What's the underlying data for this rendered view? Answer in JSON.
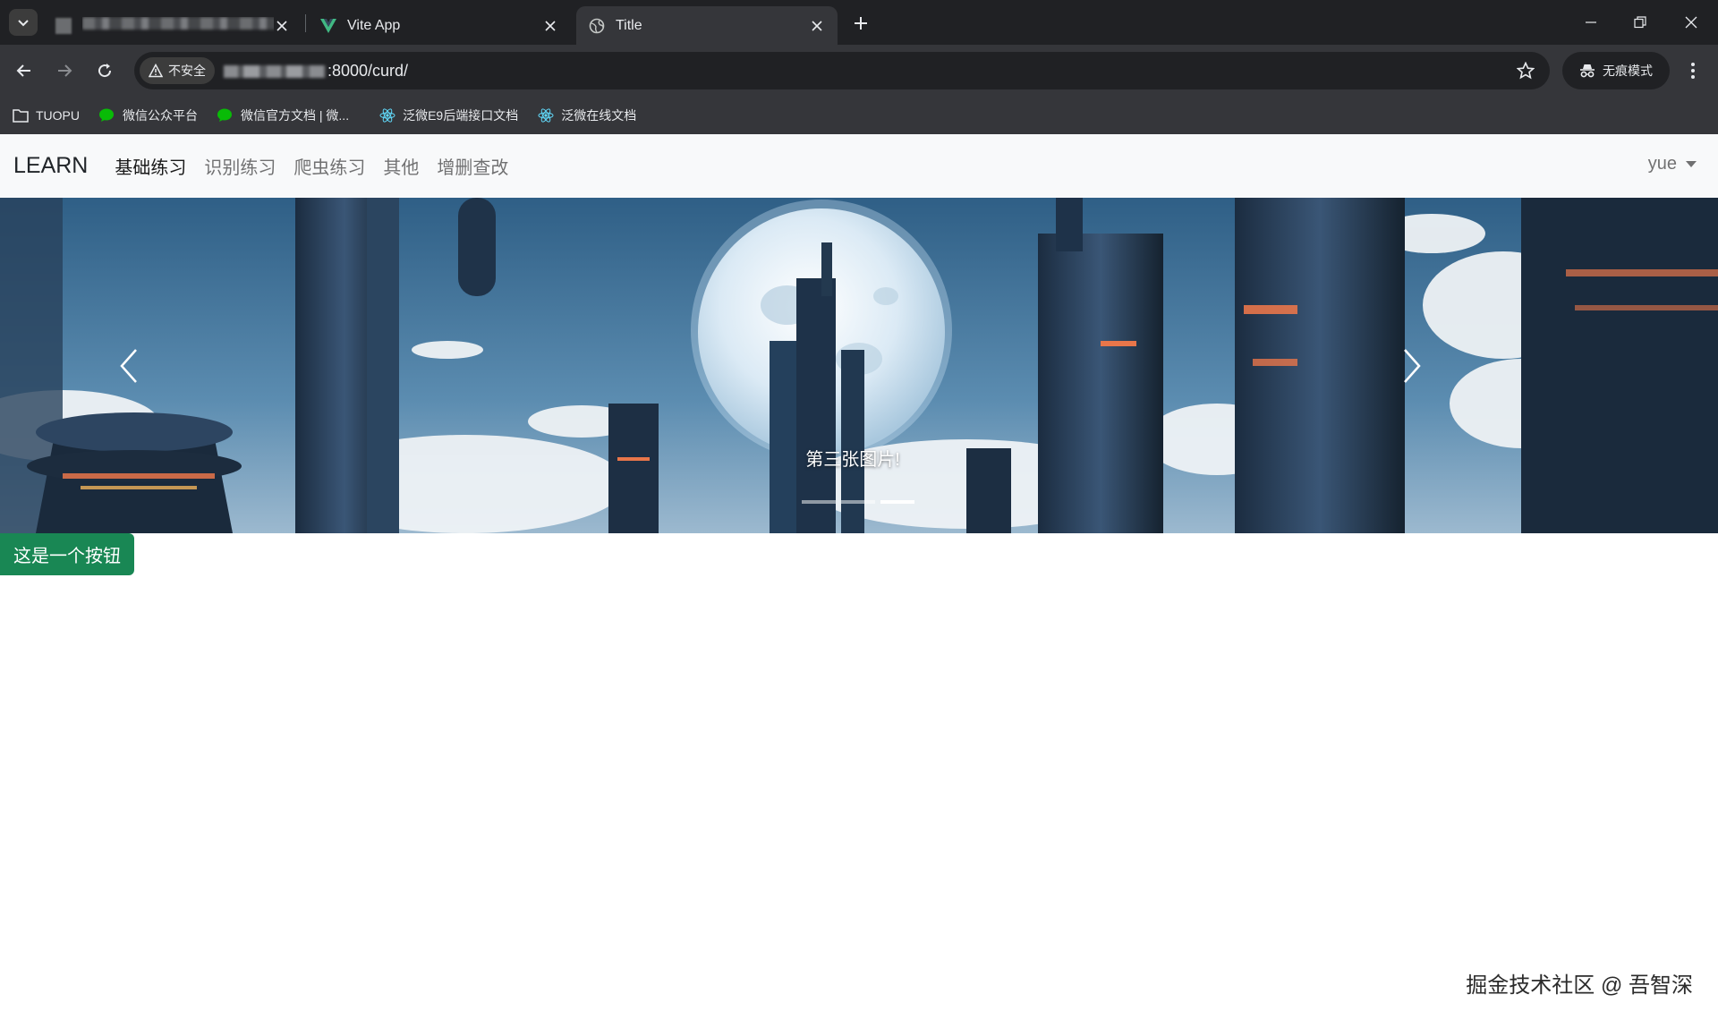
{
  "browser": {
    "tabs": [
      {
        "title": "",
        "close_icon": "close-icon"
      },
      {
        "title": "Vite App",
        "close_icon": "close-icon"
      },
      {
        "title": "Title",
        "close_icon": "close-icon"
      }
    ],
    "address": {
      "security_label": "不安全",
      "url_visible": ":8000/curd/"
    },
    "profile_label": "无痕模式",
    "bookmarks": [
      {
        "label": "TUOPU",
        "icon": "folder-icon"
      },
      {
        "label": "微信公众平台",
        "icon": "wechat-icon"
      },
      {
        "label": "微信官方文档 | 微...",
        "icon": "wechat-icon"
      },
      {
        "label": "泛微E9后端接口文档",
        "icon": "react-icon"
      },
      {
        "label": "泛微在线文档",
        "icon": "react-icon"
      }
    ]
  },
  "navbar": {
    "brand": "LEARN",
    "links": [
      {
        "label": "基础练习",
        "active": true
      },
      {
        "label": "识别练习",
        "active": false
      },
      {
        "label": "爬虫练习",
        "active": false
      },
      {
        "label": "其他",
        "active": false
      },
      {
        "label": "增删查改",
        "active": false
      }
    ],
    "user": "yue"
  },
  "carousel": {
    "caption": "第三张图片!",
    "slide_count": 3,
    "active_index": 2
  },
  "button_label": "这是一个按钮",
  "watermark": "掘金技术社区 @ 吾智深",
  "colors": {
    "chrome_dark": "#202124",
    "chrome_toolbar": "#35363a",
    "navbar_bg": "#f8f9fa",
    "button_green": "#198754"
  }
}
